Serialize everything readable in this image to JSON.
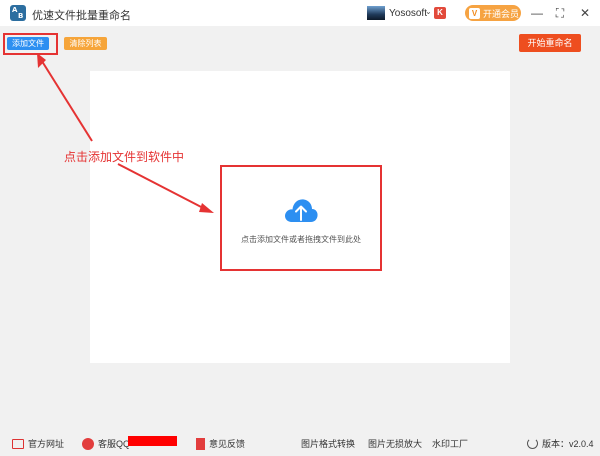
{
  "app": {
    "title": "优速文件批量重命名",
    "icon_letters": [
      "A",
      "B"
    ],
    "user_name": "Yososoft",
    "vip_label": "开通会员",
    "window_controls": {
      "minimize": "—",
      "maximize": "⛶",
      "close": "✕"
    }
  },
  "toolbar": {
    "add_label": "添加文件",
    "clear_label": "清除列表",
    "start_label": "开始重命名"
  },
  "dropzone": {
    "text": "点击添加文件或者拖拽文件到此处"
  },
  "annotation": {
    "text": "点击添加文件到软件中"
  },
  "footer": {
    "website": "官方网址",
    "qq": "客服QQ",
    "feedback": "意见反馈",
    "img_convert": "图片格式转换",
    "img_enlarge": "图片无损放大",
    "watermark": "水印工厂",
    "version": "版本：v2.0.4"
  },
  "colors": {
    "primary_blue": "#2d8ff1",
    "orange": "#f6a53a",
    "start_red": "#ee4e1f",
    "annotation_red": "#e53333"
  }
}
